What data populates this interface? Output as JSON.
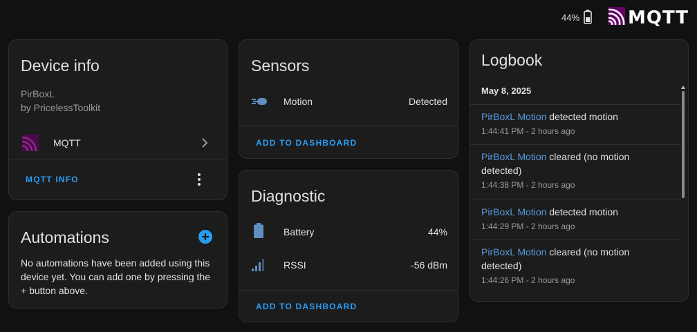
{
  "topbar": {
    "battery_percent": "44%",
    "battery_icon": "battery-icon",
    "logo_text": "MQTT",
    "logo_icon": "mqtt-waves-icon"
  },
  "device_info": {
    "title": "Device info",
    "model": "PirBoxL",
    "manufacturer": "by PricelessToolkit",
    "integration_label": "MQTT",
    "integration_icon": "mqtt-waves-icon",
    "action": "MQTT INFO"
  },
  "automations": {
    "title": "Automations",
    "message": "No automations have been added using this device yet. You can add one by pressing the + button above."
  },
  "sensors": {
    "title": "Sensors",
    "rows": [
      {
        "icon": "motion-sensor-icon",
        "name": "Motion",
        "state": "Detected"
      }
    ],
    "action": "ADD TO DASHBOARD"
  },
  "diagnostic": {
    "title": "Diagnostic",
    "rows": [
      {
        "icon": "battery-icon",
        "name": "Battery",
        "state": "44%"
      },
      {
        "icon": "signal-icon",
        "name": "RSSI",
        "state": "-56 dBm"
      }
    ],
    "action": "ADD TO DASHBOARD"
  },
  "logbook": {
    "title": "Logbook",
    "date": "May 8, 2025",
    "entries": [
      {
        "entity": "PirBoxL Motion",
        "message": " detected motion",
        "time": "1:44:41 PM - 2 hours ago"
      },
      {
        "entity": "PirBoxL Motion",
        "message": " cleared (no motion detected)",
        "time": "1:44:38 PM - 2 hours ago"
      },
      {
        "entity": "PirBoxL Motion",
        "message": " detected motion",
        "time": "1:44:29 PM - 2 hours ago"
      },
      {
        "entity": "PirBoxL Motion",
        "message": " cleared (no motion detected)",
        "time": "1:44:26 PM - 2 hours ago"
      }
    ]
  },
  "colors": {
    "accent": "#2a9df4",
    "entity_link": "#5a9be0",
    "mqtt_purple": "#660066"
  }
}
